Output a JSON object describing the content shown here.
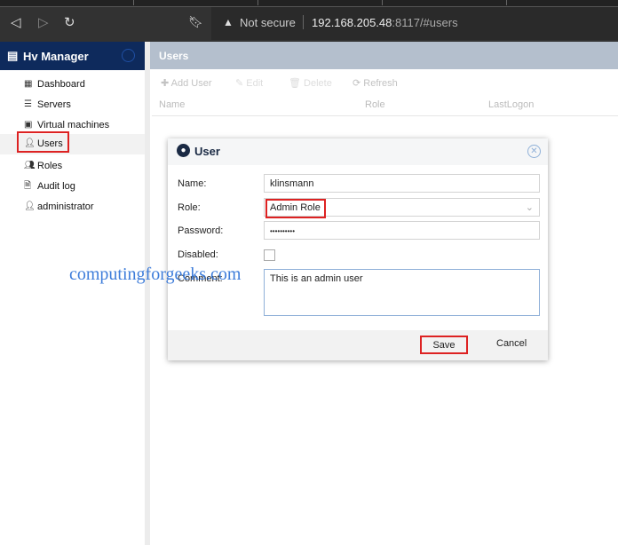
{
  "browser": {
    "security": "Not secure",
    "url_host": "192.168.205.48",
    "url_rest": ":8117/#users"
  },
  "sidebar": {
    "brand": "Hv Manager",
    "items": [
      {
        "label": "Dashboard",
        "icon": "grid-icon"
      },
      {
        "label": "Servers",
        "icon": "server-icon"
      },
      {
        "label": "Virtual machines",
        "icon": "vm-icon"
      },
      {
        "label": "Users",
        "icon": "user-icon",
        "active": true
      },
      {
        "label": "Roles",
        "icon": "users-icon"
      },
      {
        "label": "Audit log",
        "icon": "log-icon"
      },
      {
        "label": "administrator",
        "icon": "user-admin-icon"
      }
    ]
  },
  "main": {
    "title": "Users",
    "toolbar": {
      "add": "Add User",
      "edit": "Edit",
      "delete": "Delete",
      "refresh": "Refresh"
    },
    "columns": [
      "Name",
      "Role",
      "LastLogon"
    ]
  },
  "dialog": {
    "title": "User",
    "labels": {
      "name": "Name:",
      "role": "Role:",
      "password": "Password:",
      "disabled": "Disabled:",
      "comment": "Comment:"
    },
    "values": {
      "name": "klinsmann",
      "role": "Admin Role",
      "password": "••••••••••",
      "disabled": false,
      "comment": "This is an admin user"
    },
    "save": "Save",
    "cancel": "Cancel"
  },
  "watermark": "computingforgeeks.com"
}
